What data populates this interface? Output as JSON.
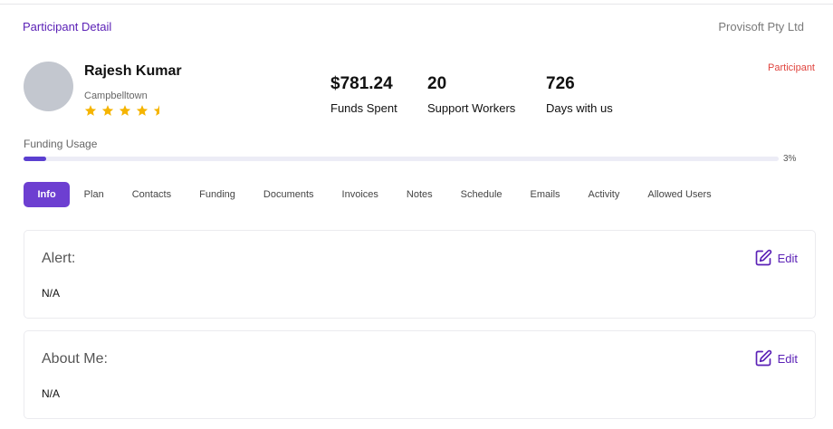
{
  "header": {
    "title": "Participant Detail",
    "company": "Provisoft Pty Ltd"
  },
  "profile": {
    "name": "Rajesh Kumar",
    "location": "Campbelltown",
    "rating": 4.5,
    "role": "Participant"
  },
  "stats": [
    {
      "value": "$781.24",
      "label": "Funds Spent"
    },
    {
      "value": "20",
      "label": "Support Workers"
    },
    {
      "value": "726",
      "label": "Days with us"
    }
  ],
  "funding": {
    "label": "Funding Usage",
    "percent_text": "3%",
    "percent": 3
  },
  "tabs": [
    {
      "label": "Info",
      "active": true
    },
    {
      "label": "Plan"
    },
    {
      "label": "Contacts"
    },
    {
      "label": "Funding"
    },
    {
      "label": "Documents"
    },
    {
      "label": "Invoices"
    },
    {
      "label": "Notes"
    },
    {
      "label": "Schedule"
    },
    {
      "label": "Emails"
    },
    {
      "label": "Activity"
    },
    {
      "label": "Allowed Users"
    }
  ],
  "cards": {
    "alert": {
      "title": "Alert:",
      "body": "N/A",
      "edit_label": "Edit"
    },
    "about": {
      "title": "About Me:",
      "body": "N/A",
      "edit_label": "Edit"
    }
  },
  "colors": {
    "accent": "#6d3fd1",
    "accent_text": "#5b21b6",
    "star": "#f5b400",
    "role": "#e0443e",
    "avatar": "#c3c7cf"
  },
  "icons": {
    "edit": "edit-square-pencil-icon",
    "star": "star-icon"
  }
}
